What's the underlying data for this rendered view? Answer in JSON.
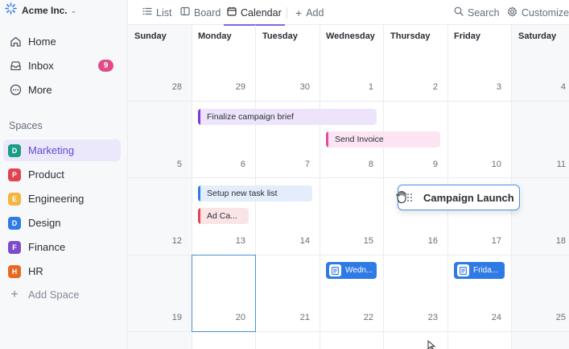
{
  "sidebar": {
    "workspace": "Acme Inc.",
    "nav": [
      {
        "label": "Home",
        "icon": "home-icon"
      },
      {
        "label": "Inbox",
        "icon": "inbox-icon",
        "badge": "9"
      },
      {
        "label": "More",
        "icon": "more-icon"
      }
    ],
    "spaces_title": "Spaces",
    "spaces": [
      {
        "letter": "D",
        "label": "Marketing",
        "color": "#1b9c85",
        "active": true
      },
      {
        "letter": "P",
        "label": "Product",
        "color": "#e04450"
      },
      {
        "letter": "E",
        "label": "Engineering",
        "color": "#f4b63f"
      },
      {
        "letter": "D",
        "label": "Design",
        "color": "#2f7be5"
      },
      {
        "letter": "F",
        "label": "Finance",
        "color": "#7e4cc9"
      },
      {
        "letter": "H",
        "label": "HR",
        "color": "#e8691f"
      }
    ],
    "add_space": "Add Space"
  },
  "topbar": {
    "tabs": [
      {
        "label": "List",
        "icon": "list-icon"
      },
      {
        "label": "Board",
        "icon": "board-icon"
      },
      {
        "label": "Calendar",
        "icon": "calendar-icon",
        "active": true
      }
    ],
    "add": "Add",
    "search": "Search",
    "customize": "Customize"
  },
  "calendar": {
    "days": [
      "Sunday",
      "Monday",
      "Tuesday",
      "Wednesday",
      "Thursday",
      "Friday",
      "Saturday"
    ],
    "weeks": [
      [
        "28",
        "29",
        "30",
        "1",
        "2",
        "3",
        "4"
      ],
      [
        "5",
        "6",
        "7",
        "8",
        "9",
        "10",
        "11"
      ],
      [
        "12",
        "13",
        "14",
        "15",
        "16",
        "17",
        "18"
      ],
      [
        "19",
        "20",
        "21",
        "22",
        "23",
        "24",
        "25"
      ]
    ],
    "events": {
      "finalize": "Finalize campaign brief",
      "send_invoice": "Send Invoice",
      "setup": "Setup new task list",
      "ad": "Ad Ca...",
      "wed": "Wedn...",
      "fri": "Frida...",
      "drag": "Campaign Launch"
    },
    "colors": {
      "purple": "#7b35d9",
      "pink": "#e14b9b",
      "blue": "#2f7be5",
      "red": "#e04450"
    }
  }
}
